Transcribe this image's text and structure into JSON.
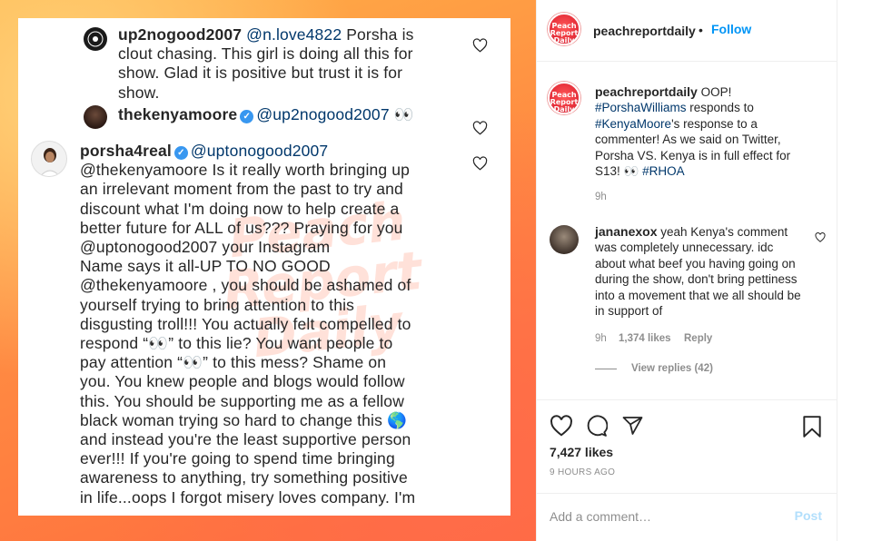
{
  "image": {
    "watermark": "Peach Report Daily",
    "comments": [
      {
        "username": "up2nogood2007",
        "mention": "@n.love4822",
        "lines": [
          " Porsha is",
          "clout chasing. This girl is doing all this for",
          "show. Glad it is positive but trust it is for",
          "show."
        ]
      },
      {
        "username": "thekenyamoore",
        "verified": true,
        "mention": "@up2nogood2007",
        "emoji": "👀"
      },
      {
        "username": "porsha4real",
        "verified": true,
        "mention": "@uptonogood2007",
        "lines": [
          "@thekenyamoore Is it really worth bringing up",
          "an irrelevant moment from the past to try and",
          "discount what I'm doing now to help create a",
          "better future for ALL of us??? Praying for you",
          "@uptonogood2007 your Instagram",
          "Name says it all-UP TO NO GOOD",
          "@thekenyamoore , you should be ashamed of",
          "yourself trying to bring attention to this",
          "disgusting troll!!! You actually felt compelled to",
          "respond “👀” to this lie? You want people to",
          "pay attention “👀” to this mess? Shame on",
          "you. You knew people and blogs would follow",
          "this. You should be supporting me as a fellow",
          "black woman trying so hard to change this 🌎",
          "and instead you're the least supportive person",
          "ever!!! If you're going to spend time bringing",
          "awareness to anything, try something positive",
          "in life...oops I forgot misery loves company. I'm"
        ]
      }
    ]
  },
  "post": {
    "header": {
      "username": "peachreportdaily",
      "separator": "•",
      "follow_label": "Follow",
      "logo_text": "Peach Report Daily"
    },
    "caption": {
      "username": "peachreportdaily",
      "text_1": " OOP! ",
      "tag_1": "#PorshaWilliams",
      "text_2": " responds to ",
      "tag_2": "#KenyaMoore",
      "text_3": "'s response to a commenter! As we said on Twitter, Porsha VS. Kenya is in full effect for S13! 👀 ",
      "tag_3": "#RHOA",
      "time": "9h"
    },
    "comment": {
      "username": "jananexox",
      "text": " yeah Kenya's comment was completely unnecessary. idc about what beef you having going on during the show, don't bring pettiness into a movement that we all should be in support of",
      "time": "9h",
      "likes": "1,374 likes",
      "reply_label": "Reply",
      "view_replies": "View replies (42)"
    },
    "likes": "7,427 likes",
    "posted_ago": "9 HOURS AGO",
    "add_comment_placeholder": "Add a comment…",
    "post_button": "Post",
    "colors": {
      "link": "#0095f6",
      "tag": "#00376b",
      "muted": "#8e8e8e",
      "post_disabled": "#b2dffc"
    },
    "icons": [
      "heart-icon",
      "comment-icon",
      "share-icon",
      "bookmark-icon"
    ]
  }
}
